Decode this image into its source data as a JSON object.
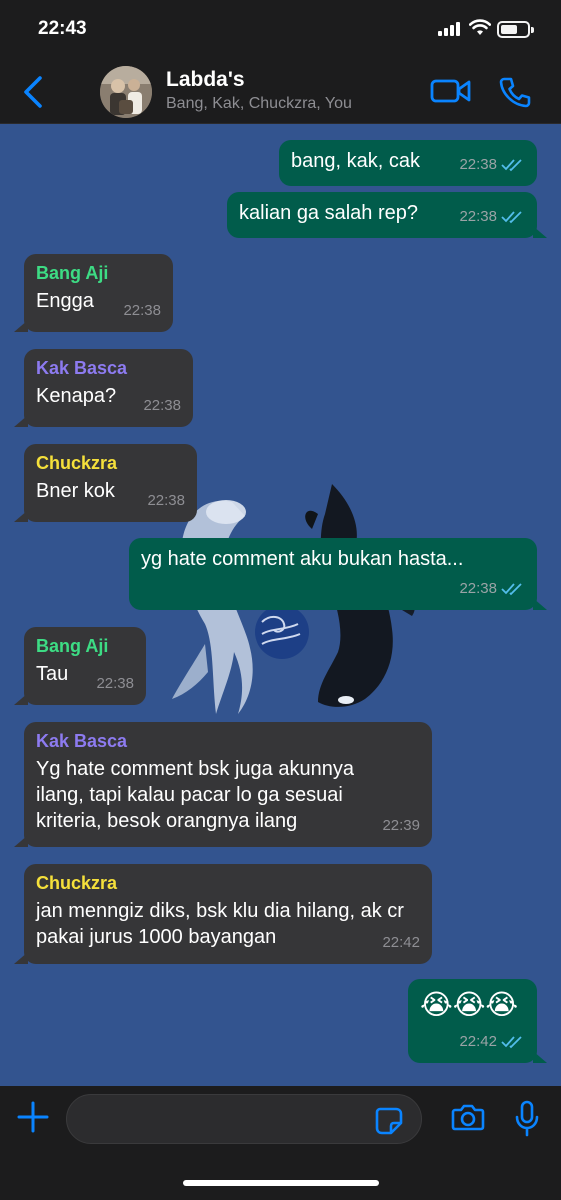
{
  "status_bar": {
    "time": "22:43"
  },
  "header": {
    "title": "Labda's",
    "subtitle": "Bang, Kak, Chuckzra, You"
  },
  "colors": {
    "accent": "#0a84ff",
    "outgoing_bubble": "#015c4b",
    "incoming_bubble": "#363638",
    "chat_background": "#33548f",
    "sender_bang_aji": "#3ddc84",
    "sender_kak_basca": "#8d7bf0",
    "sender_chuckzra": "#f5e03b",
    "read_ticks": "#53bdeb"
  },
  "messages": [
    {
      "direction": "out",
      "text": "bang, kak, cak",
      "time": "22:38",
      "status": "read"
    },
    {
      "direction": "out",
      "text": "kalian ga salah rep?",
      "time": "22:38",
      "status": "read"
    },
    {
      "direction": "in",
      "sender": "Bang Aji",
      "text": "Engga",
      "time": "22:38"
    },
    {
      "direction": "in",
      "sender": "Kak Basca",
      "text": "Kenapa?",
      "time": "22:38"
    },
    {
      "direction": "in",
      "sender": "Chuckzra",
      "text": "Bner kok",
      "time": "22:38"
    },
    {
      "direction": "out",
      "text": "yg hate comment aku bukan hasta...",
      "time": "22:38",
      "status": "read"
    },
    {
      "direction": "in",
      "sender": "Bang Aji",
      "text": "Tau",
      "time": "22:38"
    },
    {
      "direction": "in",
      "sender": "Kak Basca",
      "text": "Yg hate comment bsk juga akunnya ilang, tapi kalau pacar lo ga sesuai kriteria, besok orangnya ilang",
      "time": "22:39"
    },
    {
      "direction": "in",
      "sender": "Chuckzra",
      "text": "jan menngiz diks, bsk klu dia hilang, ak cr pakai jurus 1000 bayangan",
      "time": "22:42"
    },
    {
      "direction": "out",
      "text": "😭😭😭",
      "time": "22:42",
      "status": "read"
    }
  ],
  "composer": {
    "placeholder": ""
  },
  "icons": {
    "back": "chevron-left-icon",
    "video": "video-camera-icon",
    "call": "phone-icon",
    "plus": "plus-icon",
    "sticker": "sticker-icon",
    "camera": "camera-icon",
    "mic": "microphone-icon"
  }
}
